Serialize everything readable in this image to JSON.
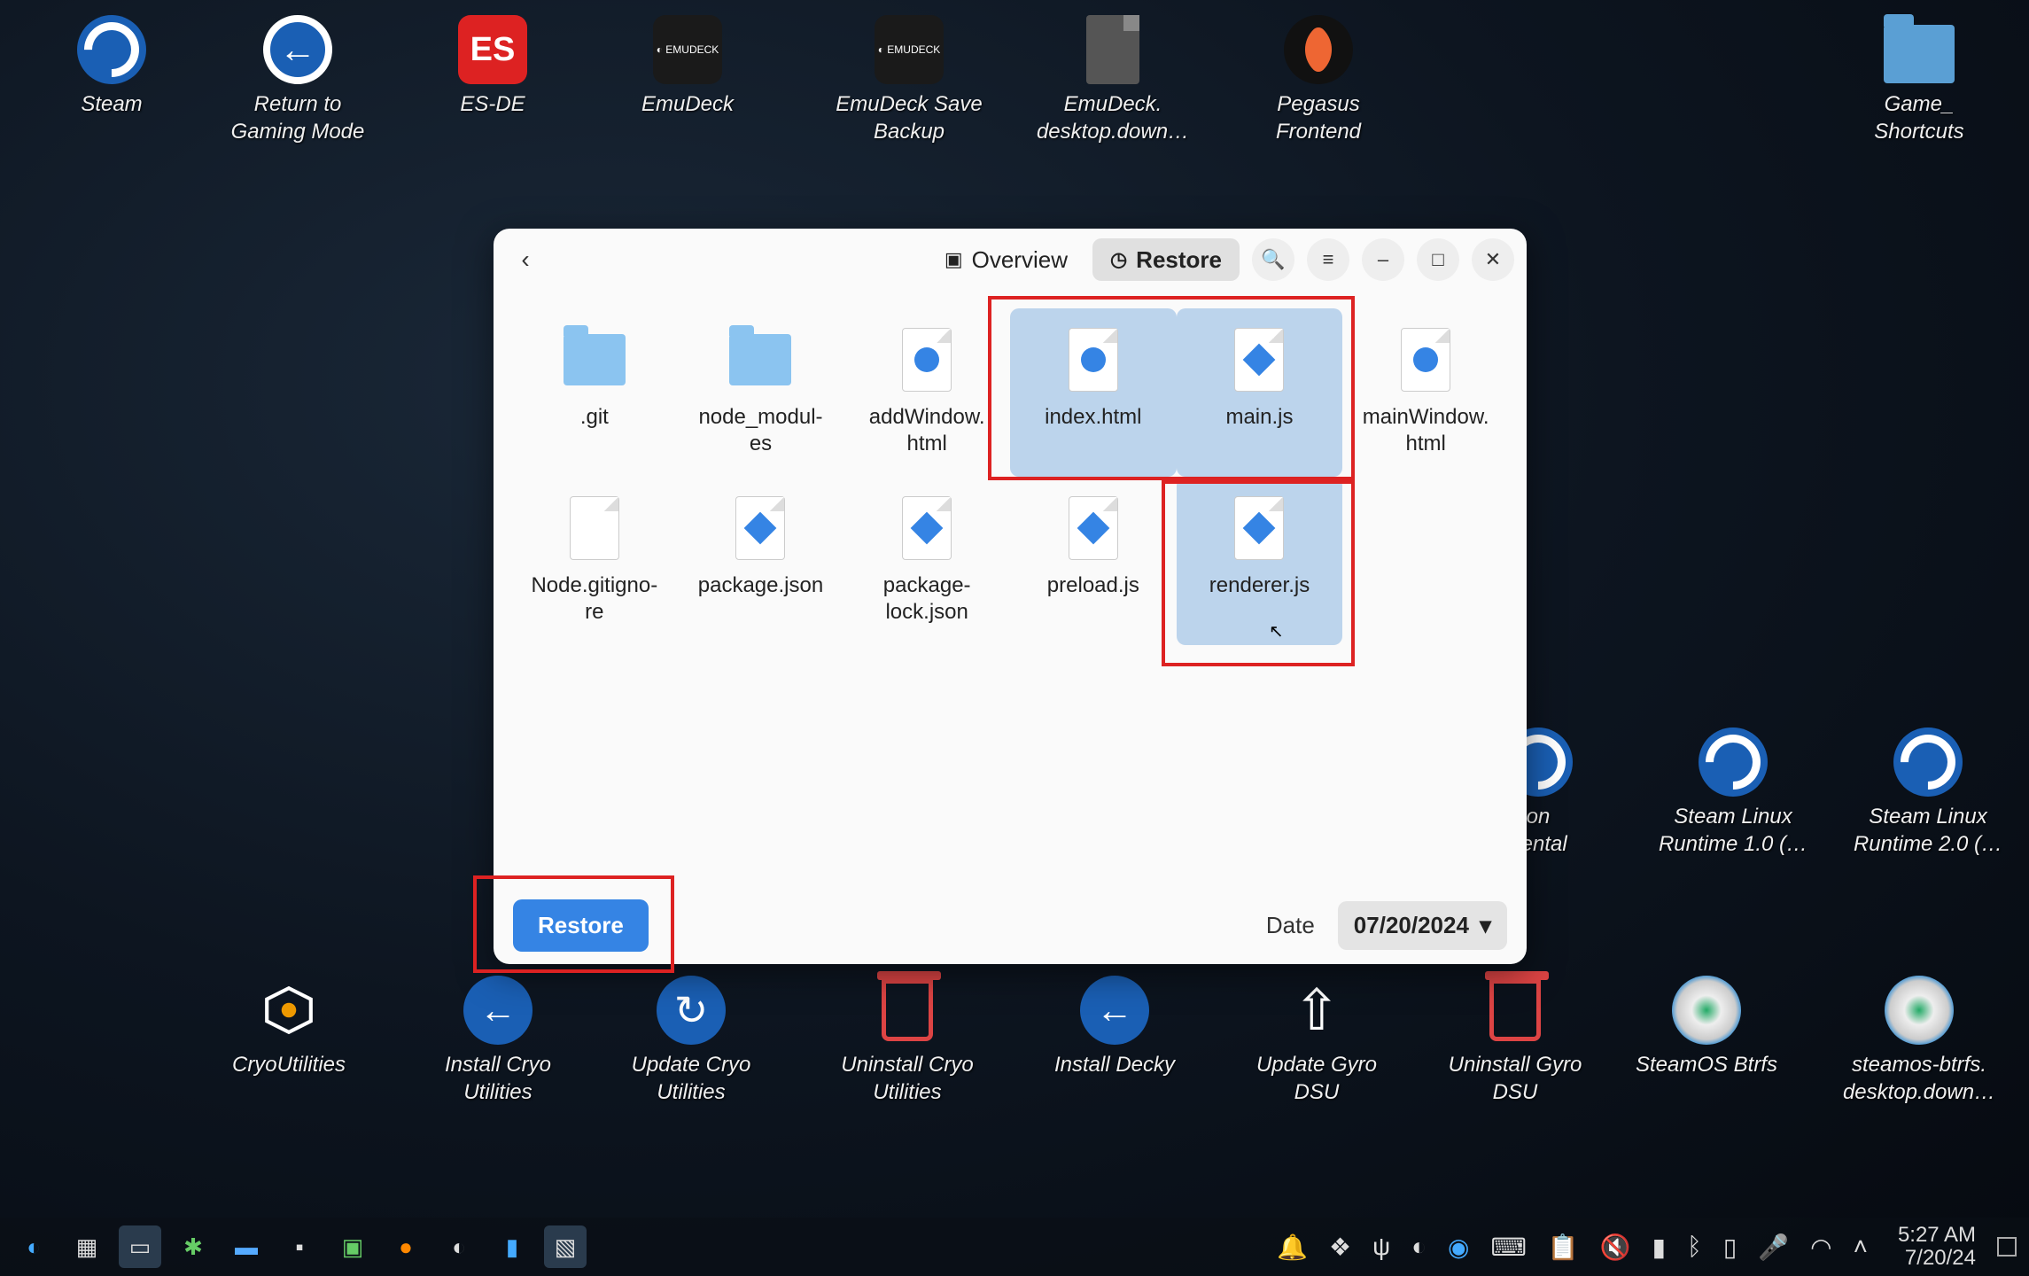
{
  "desktop_icons": {
    "row1": [
      {
        "name": "steam",
        "label": "Steam"
      },
      {
        "name": "return-gaming",
        "label": "Return to\nGaming Mode"
      },
      {
        "name": "es-de",
        "label": "ES-DE"
      },
      {
        "name": "emudeck",
        "label": "EmuDeck"
      },
      {
        "name": "emudeck-save",
        "label": "EmuDeck Save\nBackup"
      },
      {
        "name": "emudeck-down",
        "label": "EmuDeck.\ndesktop.down…"
      },
      {
        "name": "pegasus",
        "label": "Pegasus\nFrontend"
      },
      {
        "name": "game-shortcuts",
        "label": "Game_\nShortcuts"
      }
    ],
    "row2_right": [
      {
        "name": "proton-exp",
        "label": "on\nhental"
      },
      {
        "name": "steam-linux-1",
        "label": "Steam Linux\nRuntime 1.0 (…"
      },
      {
        "name": "steam-linux-2",
        "label": "Steam Linux\nRuntime 2.0 (…"
      }
    ],
    "row3": [
      {
        "name": "cryoutilities",
        "label": "CryoUtilities"
      },
      {
        "name": "install-cryo",
        "label": "Install Cryo\nUtilities"
      },
      {
        "name": "update-cryo",
        "label": "Update Cryo\nUtilities"
      },
      {
        "name": "uninstall-cryo",
        "label": "Uninstall Cryo\nUtilities"
      },
      {
        "name": "install-decky",
        "label": "Install Decky"
      },
      {
        "name": "update-gyro",
        "label": "Update Gyro\nDSU"
      },
      {
        "name": "uninstall-gyro",
        "label": "Uninstall Gyro\nDSU"
      },
      {
        "name": "steamos-btrfs",
        "label": "SteamOS Btrfs"
      },
      {
        "name": "steamos-btrfs-down",
        "label": "steamos-btrfs.\ndesktop.down…"
      }
    ]
  },
  "dialog": {
    "tabs": {
      "overview": "Overview",
      "restore": "Restore"
    },
    "files": [
      {
        "name": ".git",
        "kind": "folder",
        "selected": false
      },
      {
        "name": "node_modul-\nes",
        "kind": "folder",
        "selected": false
      },
      {
        "name": "addWindow.\nhtml",
        "kind": "html",
        "selected": false
      },
      {
        "name": "index.html",
        "kind": "html",
        "selected": true
      },
      {
        "name": "main.js",
        "kind": "js",
        "selected": true
      },
      {
        "name": "mainWindow.\nhtml",
        "kind": "html",
        "selected": false
      },
      {
        "name": "Node.gitigno-\nre",
        "kind": "blank",
        "selected": false
      },
      {
        "name": "package.json",
        "kind": "json",
        "selected": false
      },
      {
        "name": "package-\nlock.json",
        "kind": "json",
        "selected": false
      },
      {
        "name": "preload.js",
        "kind": "js",
        "selected": false
      },
      {
        "name": "renderer.js",
        "kind": "js",
        "selected": true
      }
    ],
    "restore_btn": "Restore",
    "date_label": "Date",
    "date_value": "07/20/2024"
  },
  "taskbar": {
    "time": "5:27 AM",
    "date": "7/20/24"
  }
}
